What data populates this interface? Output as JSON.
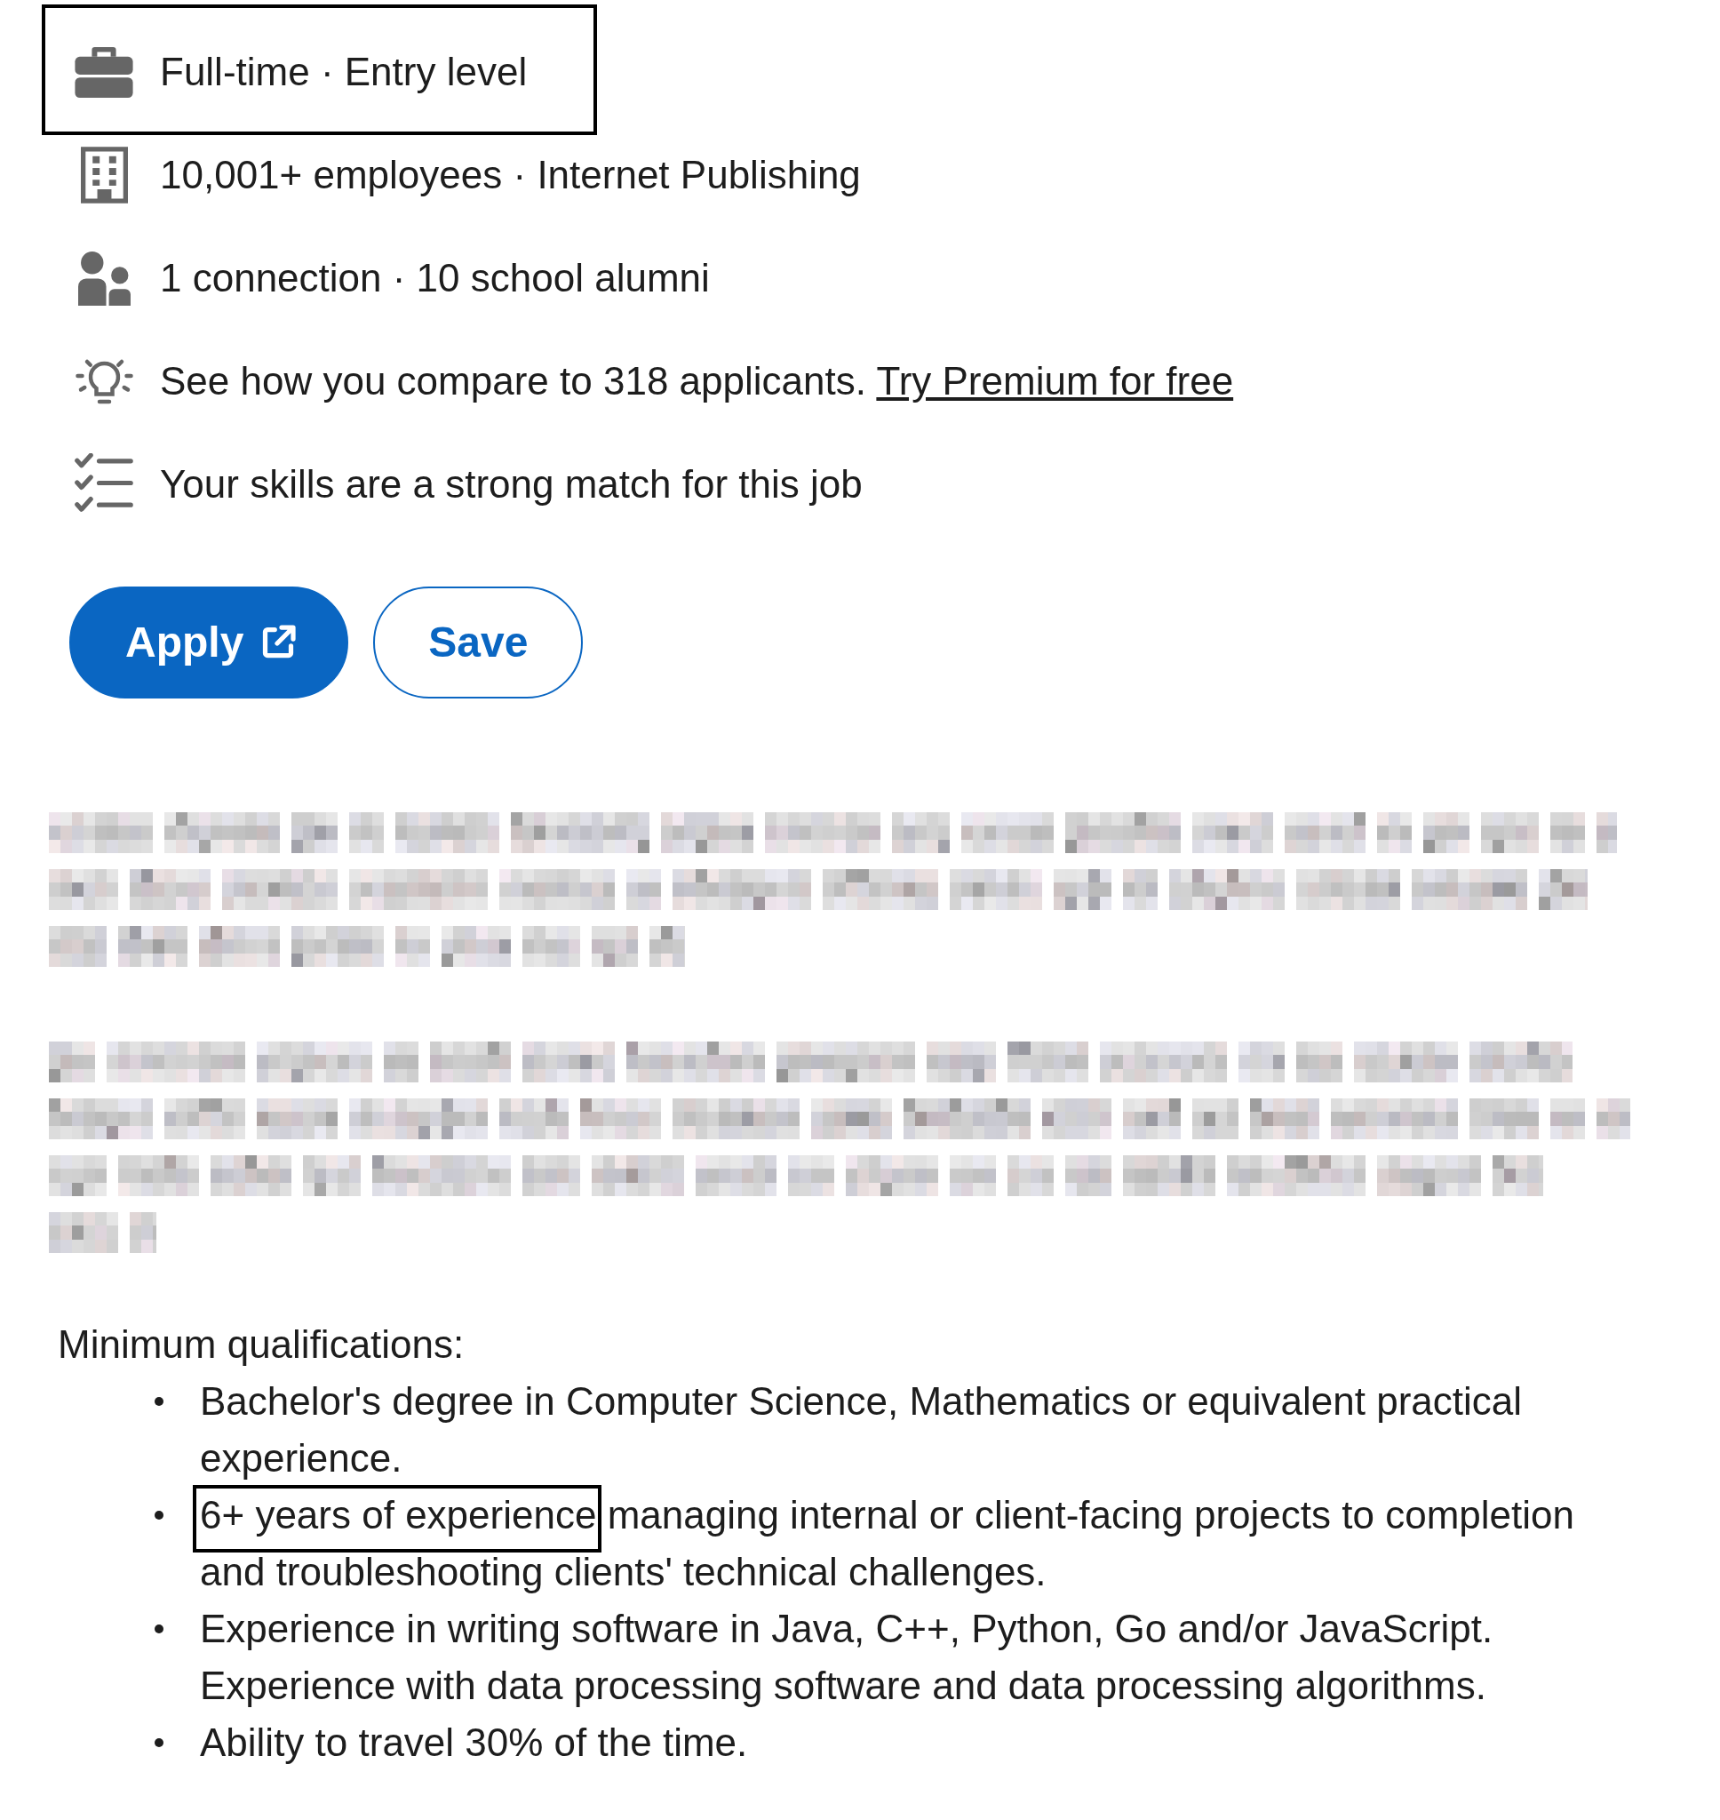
{
  "job_insights": [
    {
      "kind": "job-type",
      "text": "Full-time · Entry level",
      "highlighted": true
    },
    {
      "kind": "company",
      "text": "10,001+ employees · Internet Publishing",
      "highlighted": false
    },
    {
      "kind": "connections",
      "text": "1 connection · 10 school alumni",
      "highlighted": false
    },
    {
      "kind": "applicants",
      "text": "See how you compare to 318 applicants.",
      "link": "Try Premium for free",
      "highlighted": false
    },
    {
      "kind": "skills",
      "text": "Your skills are a strong match for this job",
      "highlighted": false
    }
  ],
  "actions": [
    {
      "kind": "apply",
      "label": "Apply",
      "external": true
    },
    {
      "kind": "save",
      "label": "Save",
      "external": false
    }
  ],
  "qualifications": {
    "heading": "Minimum qualifications:",
    "items": [
      {
        "parts": [
          {
            "text": "Bachelor's degree in Computer Science, Mathematics or equivalent practical experience.",
            "highlighted": false
          }
        ]
      },
      {
        "parts": [
          {
            "text": "6+ years of experience",
            "highlighted": true
          },
          {
            "text": "managing internal or client-facing projects to completion and troubleshooting clients' technical challenges.",
            "highlighted": false
          }
        ]
      },
      {
        "parts": [
          {
            "text": "Experience in writing software in Java, C++, Python, Go and/or JavaScript. Experience with data processing software and data processing algorithms.",
            "highlighted": false
          }
        ]
      },
      {
        "parts": [
          {
            "text": "Ability to travel 30% of the time.",
            "highlighted": false
          }
        ]
      }
    ]
  }
}
